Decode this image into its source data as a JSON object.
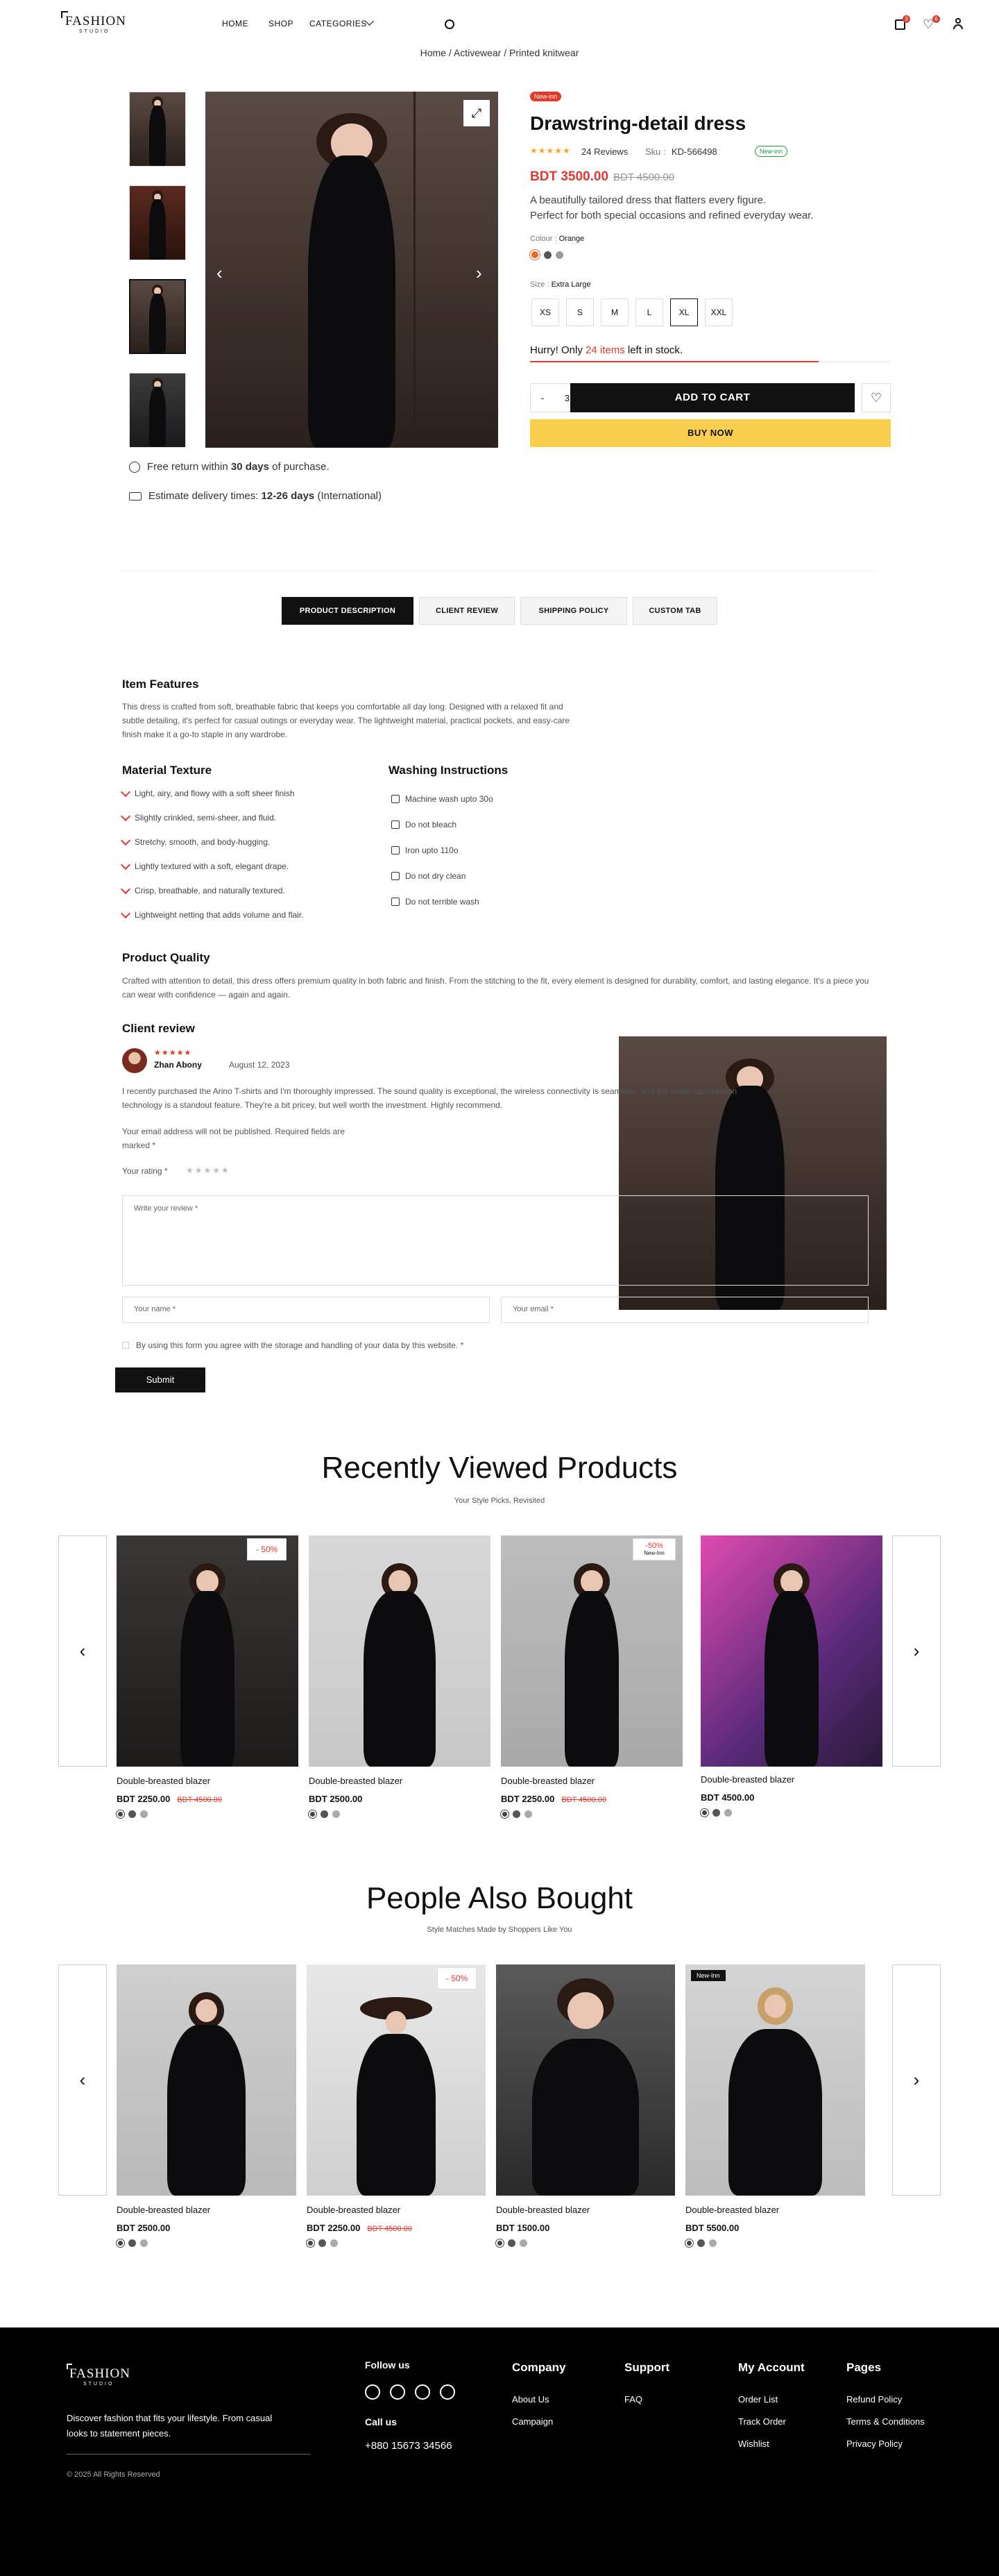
{
  "header": {
    "logo_top": "FASHION",
    "logo_sub": "STUDIO",
    "nav": [
      "HOME",
      "SHOP",
      "CATEGORIES"
    ],
    "cart_count": "3",
    "wish_count": "6"
  },
  "breadcrumb": "Home / Activewear / Printed knitwear",
  "product": {
    "badge": "New-inn",
    "title": "Drawstring-detail dress",
    "reviews": "24 Reviews",
    "sku_label": "Sku :",
    "sku": "KD-566498",
    "stock_badge": "New-inn",
    "price": "BDT 3500.00",
    "old_price": "BDT 4500.00",
    "desc1": "A beautifully tailored dress that flatters every figure.",
    "desc2": "Perfect for both special occasions and refined everyday wear.",
    "colour_label": "Colour :",
    "colour": "Orange",
    "size_label": "Size :",
    "size": "Extra Large",
    "sizes": [
      "XS",
      "S",
      "M",
      "L",
      "XL",
      "XXL"
    ],
    "hurry_pre": "Hurry! Only ",
    "hurry_items": "24 items",
    "hurry_post": " left in stock.",
    "stock_fill": 0.8,
    "qty": "3",
    "qty_minus": "-",
    "qty_plus": "+",
    "add_to_cart": "ADD TO CART",
    "buy_now": "BUY NOW",
    "return_pre": "Free return within ",
    "return_bold": "30 days",
    "return_post": " of purchase.",
    "delivery_pre": "Estimate delivery times: ",
    "delivery_bold": "12-26 days",
    "delivery_post": " (International)",
    "colors": {
      "accent": "#e03a2f",
      "yellow": "#f8cf4f"
    }
  },
  "tabs": [
    "PRODUCT DESCRIPTION",
    "CLIENT REVIEW",
    "SHIPPING POLICY",
    "CUSTOM TAB"
  ],
  "description": {
    "features_title": "Item Features",
    "features_text": "This dress is crafted from soft, breathable fabric that keeps you comfortable all day long. Designed with a relaxed fit and subtle detailing, it's perfect for casual outings or everyday wear. The lightweight material, practical pockets, and easy-care finish make it a go-to staple in any wardrobe.",
    "material_title": "Material Texture",
    "materials": [
      "Light, airy, and flowy with a soft sheer finish",
      "Slightly crinkled, semi-sheer, and fluid.",
      "Stretchy, smooth, and body-hugging.",
      "Lightly textured with a soft, elegant drape.",
      "Crisp, breathable, and naturally textured.",
      "Lightweight netting that adds volume and flair."
    ],
    "washing_title": "Washing Instructions",
    "washing": [
      "Machine wash upto 30o",
      "Do not bleach",
      "Iron upto 110o",
      "Do not dry clean",
      "Do not terrible wash"
    ],
    "quality_title": "Product Quality",
    "quality_text": "Crafted with attention to detail, this dress offers premium quality in both fabric and finish. From the stitching to the fit, every element is designed for durability, comfort, and lasting elegance. It's a piece you can wear with confidence — again and again."
  },
  "review": {
    "title": "Client review",
    "name": "Zhan Abony",
    "date": "August 12, 2023",
    "stars": "★★★★★",
    "text": "I recently purchased the Arino T-shirts and I'm thoroughly impressed. The sound quality is exceptional, the wireless connectivity is seamless, and the noise cancellation technology is a standout feature. They're a bit pricey, but well worth the investment. Highly recommend.",
    "note": "Your email address will not be published. Required fields are marked *",
    "rating_label": "Your rating *",
    "rating_stars": "★★★★★",
    "review_ph": "Write your review *",
    "name_ph": "Your name *",
    "email_ph": "Your email *",
    "consent": "By using this form you agree with the storage and handling of your data by this website. *",
    "submit": "Submit"
  },
  "recent": {
    "title": "Recently Viewed Products",
    "subtitle": "Your Style Picks, Revisited",
    "items": [
      {
        "name": "Double-breasted blazer",
        "price": "BDT 2250.00",
        "old": "BDT 4500.00",
        "badge": "- 50%"
      },
      {
        "name": "Double-breasted blazer",
        "price": "BDT 2500.00",
        "old": "",
        "badge": ""
      },
      {
        "name": "Double-breasted blazer",
        "price": "BDT 2250.00",
        "old": "BDT 4500.00",
        "badge": "-50%",
        "badge2": "New-Inn"
      },
      {
        "name": "Double-breasted blazer",
        "price": "BDT 4500.00",
        "old": "",
        "badge": ""
      }
    ]
  },
  "also": {
    "title": "People Also Bought",
    "subtitle": "Style Matches Made by Shoppers Like You",
    "items": [
      {
        "name": "Double-breasted blazer",
        "price": "BDT 2500.00",
        "old": "",
        "badge": ""
      },
      {
        "name": "Double-breasted blazer",
        "price": "BDT 2250.00",
        "old": "BDT 4500.00",
        "badge": "- 50%"
      },
      {
        "name": "Double-breasted blazer",
        "price": "BDT 1500.00",
        "old": "",
        "badge": ""
      },
      {
        "name": "Double-breasted blazer",
        "price": "BDT 5500.00",
        "old": "",
        "badge": "New-Inn"
      }
    ]
  },
  "footer": {
    "logo_top": "FASHION",
    "logo_sub": "STUDIO",
    "tagline": "Discover fashion that fits your lifestyle. From casual looks to statement pieces.",
    "copyright": "© 2025 All Rights Reserved",
    "follow": "Follow us",
    "call": "Call us",
    "phone": "+880 15673 34566",
    "company": "Company",
    "company_links": [
      "About Us",
      "Campaign"
    ],
    "support": "Support",
    "support_links": [
      "FAQ"
    ],
    "account": "My Account",
    "account_links": [
      "Order List",
      "Track Order",
      "Wishlist"
    ],
    "pages": "Pages",
    "pages_links": [
      "Refund Policy",
      "Terms & Conditions",
      "Privacy Policy"
    ]
  }
}
